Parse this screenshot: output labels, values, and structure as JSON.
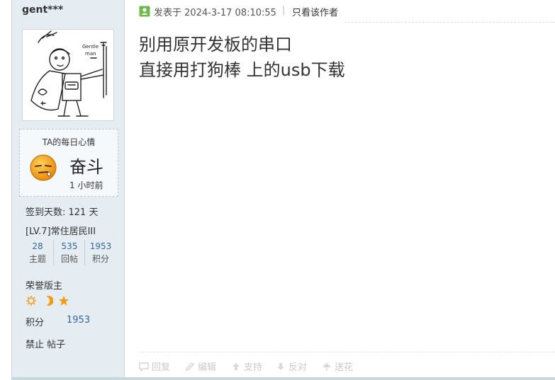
{
  "post": {
    "username": "gent***",
    "avatar_icon": "cartoon-knight-avatar",
    "avatar_text": "Gentle man",
    "mood": {
      "title": "TA的每日心情",
      "icon": "sleepy-face-icon",
      "text": "奋斗",
      "time": "1 小时前"
    },
    "signin_days": "签到天数: 121 天",
    "level": "[LV.7]常住居民III",
    "stats": [
      {
        "value": "28",
        "label": "主题"
      },
      {
        "value": "535",
        "label": "回帖"
      },
      {
        "value": "1953",
        "label": "积分"
      }
    ],
    "honor": "荣誉版主",
    "medals": [
      "sun-medal-icon",
      "moon-medal-icon",
      "star-medal-icon"
    ],
    "points_label": "积分",
    "points_value": "1953",
    "ban_label": "禁止 帖子",
    "meta": {
      "posted": "发表于 2024-3-17 08:10:55",
      "separator": "|",
      "only_author": "只看该作者"
    },
    "content": [
      "别用原开发板的串口",
      "直接用打狗棒 上的usb下载"
    ],
    "actions": {
      "reply": "回复",
      "edit": "编辑",
      "support": "支持",
      "oppose": "反对",
      "flower": "送花"
    }
  },
  "colors": {
    "sidebar_bg": "#e5edf2",
    "link": "#336699",
    "medal_orange": "#f39c12",
    "meta_icon_green": "#6fb84a"
  }
}
